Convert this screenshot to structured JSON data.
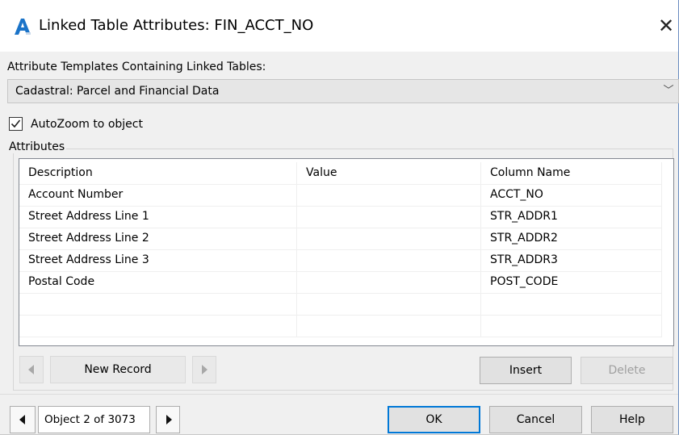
{
  "window": {
    "title": "Linked Table Attributes: FIN_ACCT_NO",
    "close_glyph": "✕",
    "app_icon": "autocad-a-icon",
    "accent": "#0078d7"
  },
  "templates": {
    "label": "Attribute Templates Containing Linked Tables:",
    "selected": "Cadastral: Parcel and Financial Data",
    "arrow_glyph": "﹀"
  },
  "autozoom": {
    "label": "AutoZoom to object",
    "checked": true
  },
  "attributes": {
    "group_label": "Attributes",
    "columns": [
      "Description",
      "Value",
      "Column Name"
    ],
    "rows": [
      {
        "description": "Account Number",
        "value": "",
        "column": "ACCT_NO"
      },
      {
        "description": "Street Address Line 1",
        "value": "",
        "column": "STR_ADDR1"
      },
      {
        "description": "Street Address Line 2",
        "value": "",
        "column": "STR_ADDR2"
      },
      {
        "description": "Street Address Line 3",
        "value": "",
        "column": "STR_ADDR3"
      },
      {
        "description": "Postal Code",
        "value": "",
        "column": "POST_CODE"
      },
      {
        "description": "",
        "value": "",
        "column": ""
      },
      {
        "description": "",
        "value": "",
        "column": ""
      }
    ]
  },
  "record_nav": {
    "label": "New Record",
    "insert_label": "Insert",
    "delete_label": "Delete"
  },
  "object_nav": {
    "label": "Object 2 of 3073"
  },
  "footer": {
    "ok_label": "OK",
    "cancel_label": "Cancel",
    "help_label": "Help"
  }
}
